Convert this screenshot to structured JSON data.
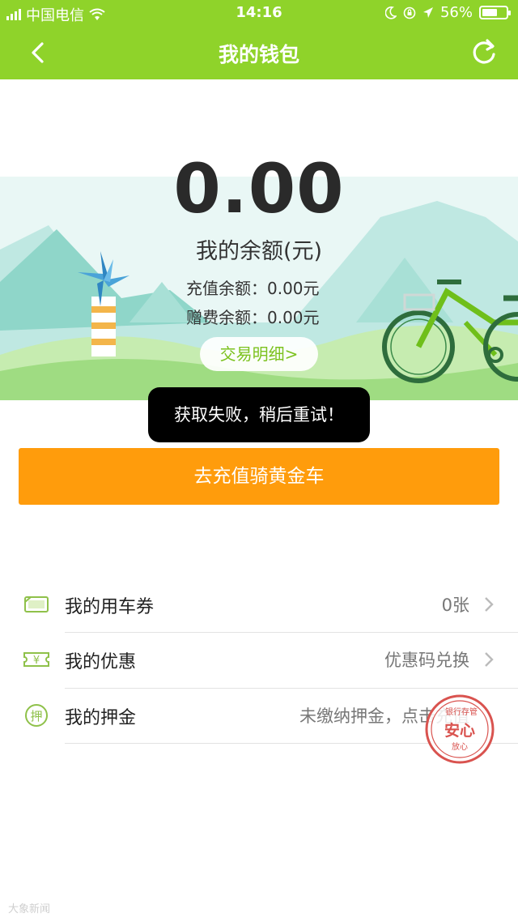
{
  "status_bar": {
    "carrier": "中国电信",
    "time": "14:16",
    "battery": "56%"
  },
  "nav": {
    "title": "我的钱包"
  },
  "wallet": {
    "balance": "0.00",
    "balance_label": "我的余额(元)",
    "recharge_balance": "充值余额：0.00元",
    "bonus_balance": "赠费余额：0.00元",
    "detail_button": "交易明细>"
  },
  "toast": "获取失败，稍后重试！",
  "recharge_button": "去充值骑黄金车",
  "list": [
    {
      "label": "我的用车券",
      "value": "0张",
      "icon": "ticket-icon"
    },
    {
      "label": "我的优惠",
      "value": "优惠码兑换",
      "icon": "coupon-icon"
    },
    {
      "label": "我的押金",
      "value": "未缴纳押金，点击充值",
      "icon": "deposit-icon"
    }
  ],
  "icon_text": {
    "deposit": "押",
    "coupon": "¥"
  },
  "stamp": {
    "top_text": "银行存管",
    "main_text": "安心",
    "bottom_text": "放心"
  },
  "watermark": "大象新闻",
  "colors": {
    "header": "#8fd32a",
    "accent_green": "#7cc21f",
    "recharge_button": "#ff9c0c",
    "toast_bg": "#000000",
    "stamp": "#d9534f"
  }
}
